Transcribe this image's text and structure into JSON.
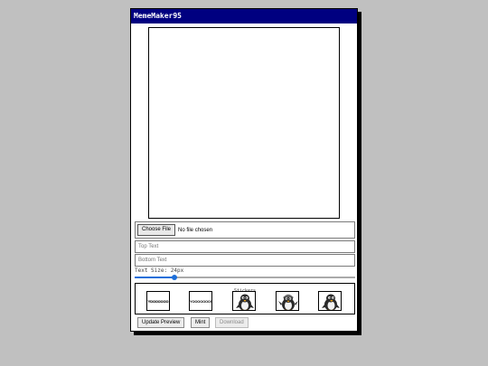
{
  "window": {
    "title": "MemeMaker95"
  },
  "file": {
    "button_label": "Choose File",
    "status": "No file chosen"
  },
  "inputs": {
    "top_placeholder": "Top Text",
    "bottom_placeholder": "Bottom Text"
  },
  "text_size": {
    "label": "Text Size: 24px",
    "fraction": 0.18
  },
  "stickers": {
    "legend": "Stickers",
    "items": [
      {
        "name": "yooooooo-text-sticker",
        "text": "YOOOOOOO",
        "style": "outlined"
      },
      {
        "name": "yooooooo-bold-sticker",
        "text": "YOOOOOOO!",
        "style": "bold"
      },
      {
        "name": "penguin-sticker-1",
        "icon": "penguin"
      },
      {
        "name": "penguin-sticker-2",
        "icon": "penguin-helmet"
      },
      {
        "name": "penguin-sticker-3",
        "icon": "penguin"
      }
    ]
  },
  "actions": {
    "update_preview": "Update Preview",
    "mint": "Mint",
    "download": "Download"
  },
  "colors": {
    "titlebar": "#000080",
    "desktop": "#c0c0c0",
    "accent": "#1e6fd9"
  }
}
